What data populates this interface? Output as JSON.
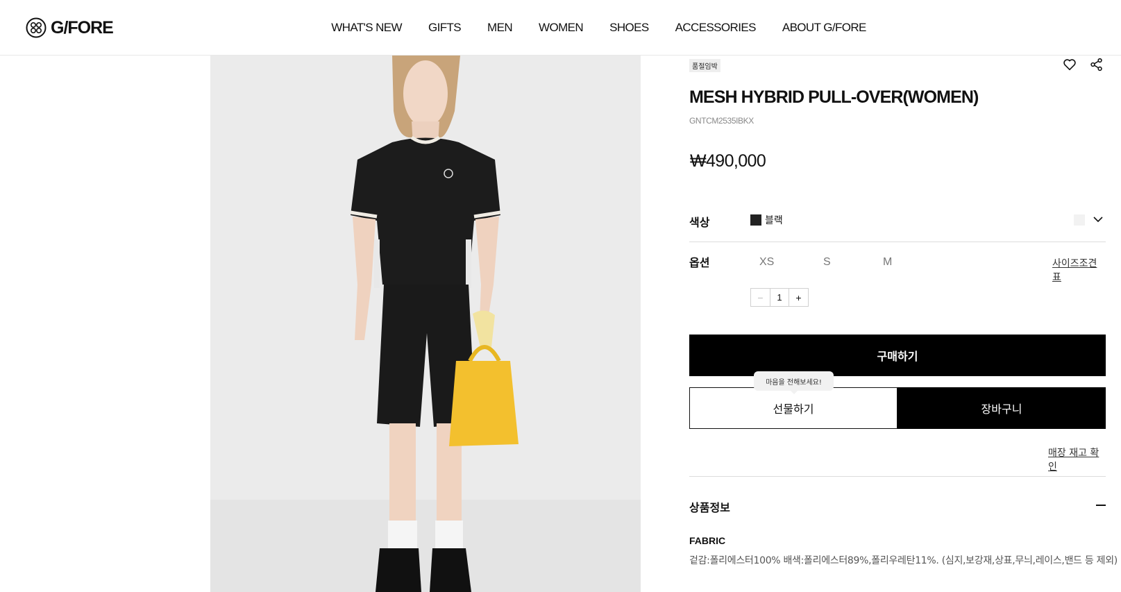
{
  "brand": {
    "name": "G/FORE"
  },
  "nav": {
    "items": [
      "WHAT'S NEW",
      "GIFTS",
      "MEN",
      "WOMEN",
      "SHOES",
      "ACCESSORIES",
      "ABOUT G/FORE"
    ]
  },
  "product": {
    "badge": "품절임박",
    "title": "MESH HYBRID PULL-OVER(WOMEN)",
    "sku": "GNTCM2535IBKX",
    "price": "₩490,000",
    "color_label": "색상",
    "color_value": "블랙",
    "color_hex": "#222222",
    "option_label": "옵션",
    "sizes": [
      "XS",
      "S",
      "M"
    ],
    "size_chart_link": "사이즈조견표",
    "quantity": "1",
    "qty_minus": "−",
    "qty_plus": "+",
    "buy_label": "구매하기",
    "gift_label": "선물하기",
    "cart_label": "장바구니",
    "gift_tooltip": "마음을 전해보세요!",
    "stock_link": "매장 재고 확인",
    "info_heading": "상품정보",
    "fabric_label": "FABRIC",
    "fabric_text": "겉감:폴리에스터100% 배색:폴리에스터89%,폴리우레탄11%. (심지,보강재,상표,무늬,레이스,밴드 등 제외)"
  },
  "icons": {
    "wishlist": "heart-icon",
    "share": "share-icon",
    "dropdown": "chevron-down-icon",
    "collapse": "minus-icon"
  }
}
